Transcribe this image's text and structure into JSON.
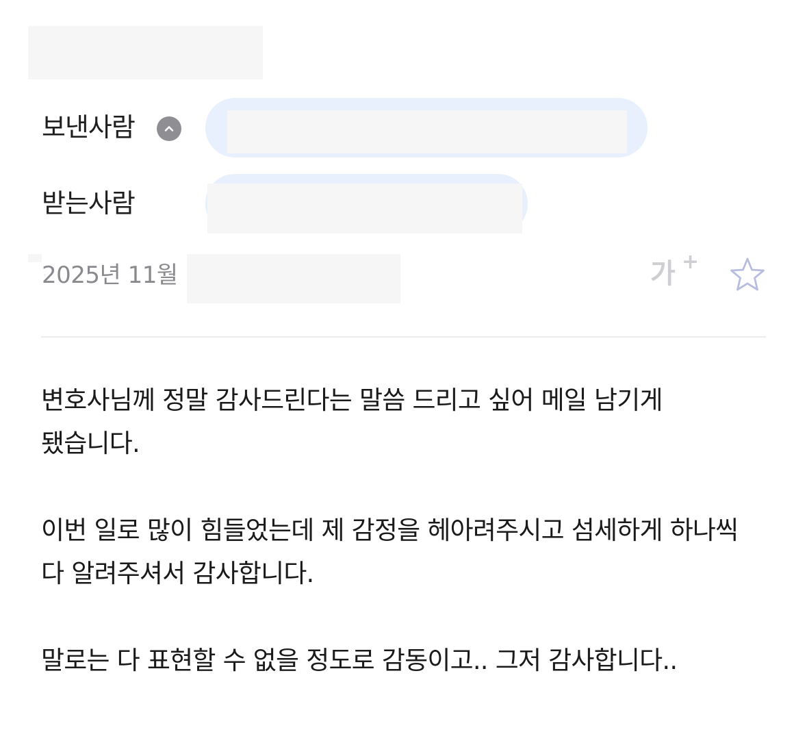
{
  "header": {
    "sender_label": "보낸사람",
    "recipient_label": "받는사람",
    "toggle_icon": "chevron-up-icon",
    "date_text": "2025년 11월",
    "font_size_button_glyph": "가",
    "font_size_button_plus": "+",
    "star_icon": "star-outline-icon"
  },
  "colors": {
    "chip_background": "#e8f0fd",
    "toggle_background": "#8e8e93",
    "date_text": "#8a8a8e",
    "icon_light": "#cfcfd3",
    "star_outline": "#b8bde0"
  },
  "body": {
    "paragraphs": [
      "변호사님께 정말 감사드린다는 말씀 드리고 싶어 메일 남기게 됐습니다.",
      "이번 일로 많이 힘들었는데 제 감정을 헤아려주시고 섬세하게 하나씩 다 알려주셔서 감사합니다.",
      "말로는 다 표현할 수 없을 정도로 감동이고.. 그저 감사합니다.."
    ]
  }
}
